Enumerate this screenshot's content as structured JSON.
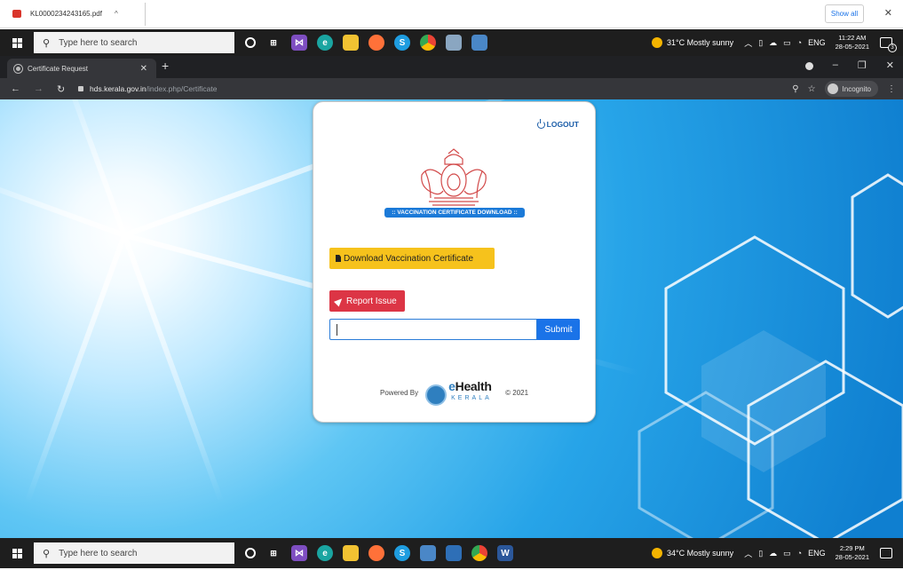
{
  "download_bar": {
    "file_name": "KL0000234243165.pdf",
    "show_all": "Show all",
    "close": "✕"
  },
  "taskbar_top": {
    "search_placeholder": "Type here to search",
    "weather": "31°C  Mostly sunny",
    "time": "11:22 AM",
    "date": "28-05-2021",
    "lang": "ENG",
    "notifications": "3"
  },
  "taskbar_bottom": {
    "search_placeholder": "Type here to search",
    "weather": "34°C  Mostly sunny",
    "time": "2:29 PM",
    "date": "28-05-2021",
    "lang": "ENG"
  },
  "browser": {
    "tab_title": "Certificate Request",
    "url_host": "hds.kerala.gov.in",
    "url_path": "/index.php/Certificate",
    "incognito_label": "Incognito"
  },
  "card": {
    "logout_label": "LOGOUT",
    "banner_text": ":: VACCINATION CERTIFICATE DOWNLOAD ::",
    "download_button": "Download Vaccination Certificate",
    "report_button": "Report Issue",
    "input_value": "",
    "submit_button": "Submit",
    "powered_by": "Powered By",
    "brand_e": "e",
    "brand_health": "Health",
    "brand_kerala": "KERALA",
    "copyright": "© 2021"
  },
  "colors": {
    "download_button": "#f6c21c",
    "report_button": "#dc3545",
    "submit_button": "#1a73e8",
    "banner": "#1b7ad8",
    "logout": "#1b5da8"
  }
}
